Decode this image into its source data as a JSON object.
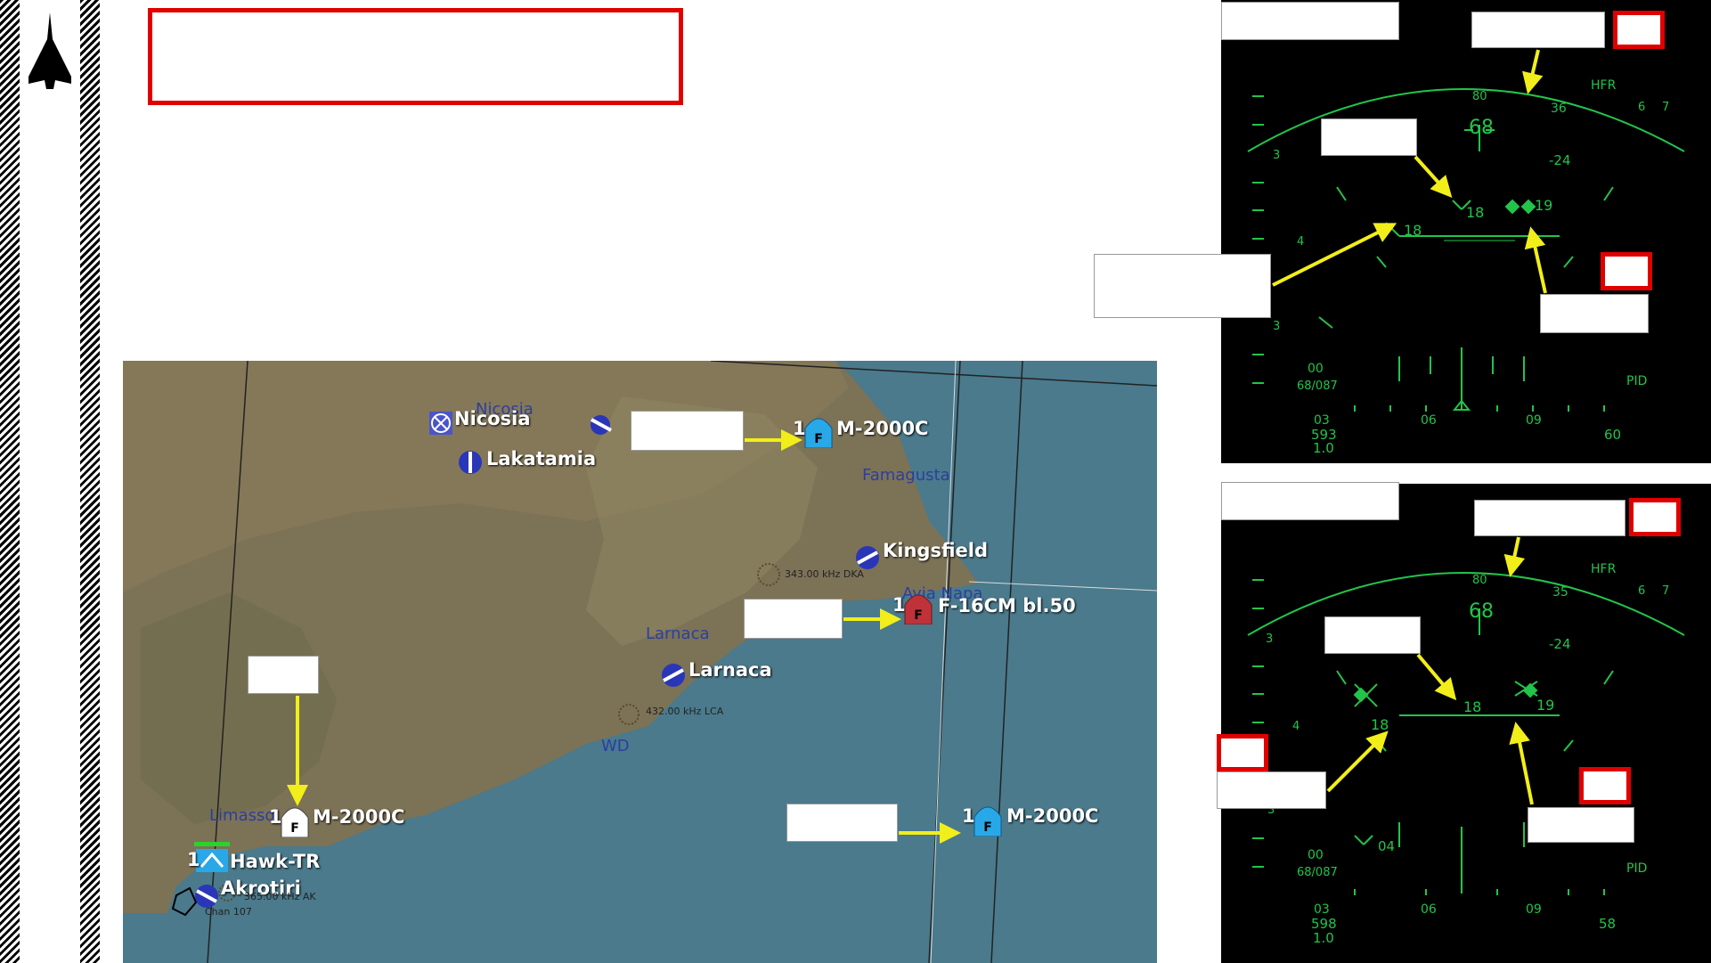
{
  "map": {
    "places": {
      "nicosia_city": "Nicosia",
      "famagusta": "Famagusta",
      "ayia_napa": "Ayia Napa",
      "larnaca_city": "Larnaca",
      "wd": "WD",
      "limassol": "Limassol"
    },
    "airfields": {
      "nicosia": "Nicosia",
      "lakatamia": "Lakatamia",
      "kingsfield": "Kingsfield",
      "larnaca": "Larnaca",
      "akrotiri": "Akrotiri"
    },
    "navaids": {
      "dka": "343.00 kHz DKA",
      "lca": "432.00 kHz LCA",
      "ak": "365.00 kHz AK",
      "chan": "Chan 107"
    },
    "units": {
      "m2000_north": {
        "count": "1",
        "name": "M-2000C",
        "letter": "F"
      },
      "f16": {
        "count": "1",
        "name": "F-16CM bl.50",
        "letter": "F"
      },
      "m2000_limassol": {
        "count": "1",
        "name": "M-2000C",
        "letter": "F"
      },
      "m2000_sea": {
        "count": "1",
        "name": "M-2000C",
        "letter": "F"
      },
      "hawk": {
        "count": "1",
        "name": "Hawk-TR"
      }
    },
    "colors": {
      "friendly": "#29a8e8",
      "hostile": "#c0323a",
      "neutral": "#ffffff",
      "arrow": "#f2ee1a"
    }
  },
  "mfd_top": {
    "labels": {
      "hfr": "HFR",
      "tick_80": "80",
      "tick_36": "36",
      "six": "6",
      "seven": "7",
      "alt": "68",
      "neg24": "-24",
      "three": "3",
      "eighteen": "18",
      "nineteen": "19",
      "minus18": "18",
      "four": "4",
      "three_low": "3",
      "zero_zero": "00",
      "bearing": "68/087",
      "pid": "PID",
      "b03": "03",
      "b06": "06",
      "b09": "09",
      "n593": "593",
      "n10": "1.0",
      "n60": "60"
    }
  },
  "mfd_bottom": {
    "labels": {
      "hfr": "HFR",
      "tick_80": "80",
      "tick_35": "35",
      "six": "6",
      "seven": "7",
      "alt": "68",
      "neg24": "-24",
      "three": "3",
      "eighteen": "18",
      "nineteen": "19",
      "minus18": "18",
      "four": "4",
      "three_low": "3",
      "o4": "04",
      "zero_zero": "00",
      "bearing": "68/087",
      "pid": "PID",
      "b03": "03",
      "b06": "06",
      "b09": "09",
      "n598": "598",
      "n10": "1.0",
      "n58": "58"
    }
  }
}
